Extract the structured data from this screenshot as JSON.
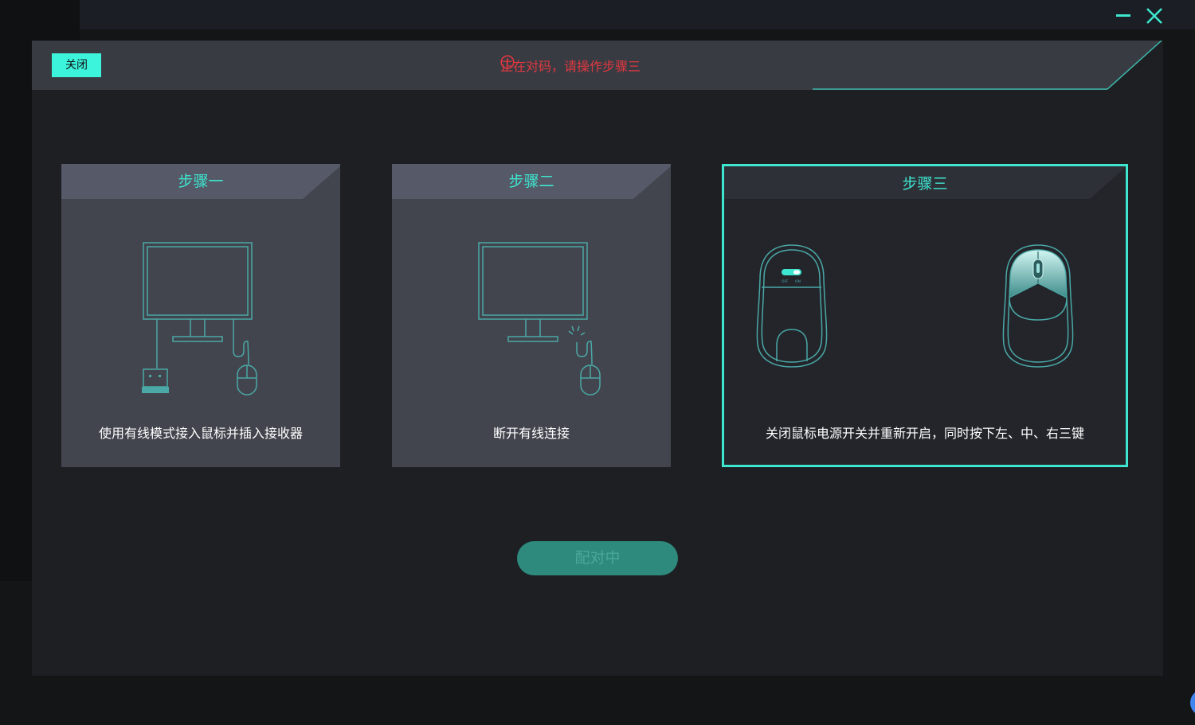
{
  "window": {
    "minimize_icon": "minimize-icon",
    "close_icon": "close-icon"
  },
  "header": {
    "close_label": "关闭",
    "status_icon": "alert-circle-icon",
    "status_text": "正在对码，请操作步骤三"
  },
  "steps": [
    {
      "title": "步骤一",
      "description": "使用有线模式接入鼠标并插入接收器",
      "illustration": "monitor-receiver-mouse-icon"
    },
    {
      "title": "步骤二",
      "description": "断开有线连接",
      "illustration": "monitor-unplug-mouse-icon"
    },
    {
      "title": "步骤三",
      "description": "关闭鼠标电源开关并重新开启，同时按下左、中、右三键",
      "illustration": "mouse-power-switch-and-buttons-icon",
      "switch_labels": [
        "OFF",
        "ON"
      ]
    }
  ],
  "pair_button": {
    "label": "配对中"
  },
  "colors": {
    "accent": "#3ee6cf",
    "alert": "#e0383f",
    "card": "#43454e",
    "active_card": "#23252b",
    "button": "#2d8a7d"
  }
}
